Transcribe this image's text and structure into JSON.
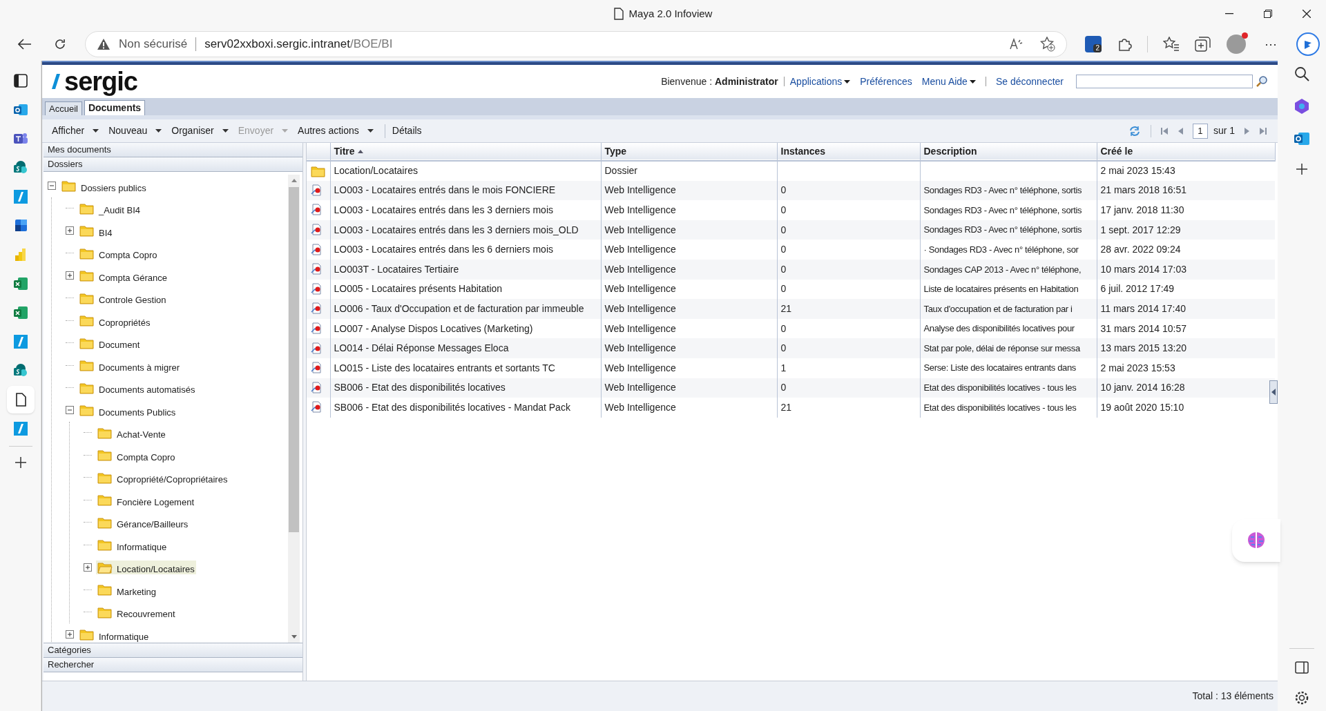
{
  "browser": {
    "title": "Maya 2.0 Infoview",
    "security": "Non sécurisé",
    "url_host": "serv02xxboxi.sergic.intranet",
    "url_path": "/BOE/BI",
    "extension_badge": "2",
    "more": "···"
  },
  "header": {
    "logo": "sergic",
    "welcome": "Bienvenue : **Administrator**",
    "links": [
      {
        "label": "Applications",
        "dropdown": true
      },
      {
        "label": "Préférences",
        "dropdown": false
      },
      {
        "label": "Menu Aide",
        "dropdown": true
      }
    ],
    "logout": "Se déconnecter"
  },
  "tabs": [
    {
      "label": "Accueil",
      "selected": false
    },
    {
      "label": "Documents",
      "selected": true
    }
  ],
  "toolbar": [
    {
      "label": "Afficher",
      "dropdown": true,
      "disabled": false
    },
    {
      "label": "Nouveau",
      "dropdown": true,
      "disabled": false
    },
    {
      "label": "Organiser",
      "dropdown": true,
      "disabled": false
    },
    {
      "label": "Envoyer",
      "dropdown": true,
      "disabled": true
    },
    {
      "label": "Autres actions",
      "dropdown": true,
      "disabled": false
    },
    {
      "label": "Détails",
      "dropdown": false,
      "disabled": false
    }
  ],
  "pager": {
    "page": "1",
    "of": "sur 1"
  },
  "sidebar": {
    "sections_top": [
      "Mes documents",
      "Dossiers"
    ],
    "sections_bottom": [
      "Catégories",
      "Rechercher"
    ],
    "tree": [
      {
        "label": "Dossiers publics",
        "kind": "expanded",
        "selected": false,
        "children": [
          {
            "label": "_Audit BI4",
            "kind": "leaf",
            "selected": false
          },
          {
            "label": "BI4",
            "kind": "collapsed",
            "selected": false
          },
          {
            "label": "Compta Copro",
            "kind": "leaf",
            "selected": false
          },
          {
            "label": "Compta Gérance",
            "kind": "collapsed",
            "selected": false
          },
          {
            "label": "Controle Gestion",
            "kind": "leaf",
            "selected": false
          },
          {
            "label": "Copropriétés",
            "kind": "leaf",
            "selected": false
          },
          {
            "label": "Document",
            "kind": "leaf",
            "selected": false
          },
          {
            "label": "Documents à migrer",
            "kind": "leaf",
            "selected": false
          },
          {
            "label": "Documents automatisés",
            "kind": "leaf",
            "selected": false
          },
          {
            "label": "Documents Publics",
            "kind": "expanded",
            "selected": false,
            "children": [
              {
                "label": "Achat-Vente",
                "kind": "leaf",
                "selected": false
              },
              {
                "label": "Compta Copro",
                "kind": "leaf",
                "selected": false
              },
              {
                "label": "Copropriété/Copropriétaires",
                "kind": "leaf",
                "selected": false
              },
              {
                "label": "Foncière Logement",
                "kind": "leaf",
                "selected": false
              },
              {
                "label": "Gérance/Bailleurs",
                "kind": "leaf",
                "selected": false
              },
              {
                "label": "Informatique",
                "kind": "leaf",
                "selected": false
              },
              {
                "label": "Location/Locataires",
                "kind": "collapsed",
                "selected": true
              },
              {
                "label": "Marketing",
                "kind": "leaf",
                "selected": false
              },
              {
                "label": "Recouvrement",
                "kind": "leaf",
                "selected": false
              }
            ]
          },
          {
            "label": "Informatique",
            "kind": "collapsed",
            "selected": false
          }
        ]
      }
    ]
  },
  "table": {
    "columns": [
      "Titre",
      "Type",
      "Instances",
      "Description",
      "Créé le"
    ],
    "rows": [
      {
        "kind": "folder",
        "cells": [
          "Location/Locataires",
          "Dossier",
          "",
          "",
          "2 mai 2023 15:43"
        ]
      },
      {
        "kind": "report",
        "cells": [
          "LO003 - Locataires entrés dans le mois FONCIERE",
          "Web Intelligence",
          "0",
          "Sondages RD3 - Avec n° téléphone, sortis",
          "21 mars 2018 16:51"
        ]
      },
      {
        "kind": "report",
        "cells": [
          "LO003 - Locataires entrés dans les 3 derniers mois",
          "Web Intelligence",
          "0",
          "Sondages RD3 - Avec n° téléphone, sortis",
          "17 janv. 2018 11:30"
        ]
      },
      {
        "kind": "report",
        "cells": [
          "LO003 - Locataires entrés dans les 3 derniers mois_OLD",
          "Web Intelligence",
          "0",
          "Sondages RD3 - Avec n° téléphone, sortis",
          "1 sept. 2017 12:29"
        ]
      },
      {
        "kind": "report",
        "cells": [
          "LO003 - Locataires entrés dans les 6 derniers mois",
          "Web Intelligence",
          "0",
          "· Sondages RD3 - Avec n° téléphone, sor",
          "28 avr. 2022 09:24"
        ]
      },
      {
        "kind": "report",
        "cells": [
          "LO003T - Locataires Tertiaire",
          "Web Intelligence",
          "0",
          "Sondages CAP 2013 - Avec n° téléphone,",
          "10 mars 2014 17:03"
        ]
      },
      {
        "kind": "report",
        "cells": [
          "LO005 - Locataires présents Habitation",
          "Web Intelligence",
          "0",
          "Liste de locataires présents en Habitation",
          "6 juil. 2012 17:49"
        ]
      },
      {
        "kind": "report",
        "cells": [
          "LO006 - Taux d'Occupation et de facturation par immeuble",
          "Web Intelligence",
          "21",
          "Taux d'occupation et de facturation par i",
          "11 mars 2014 17:40"
        ]
      },
      {
        "kind": "report",
        "cells": [
          "LO007 - Analyse Dispos Locatives (Marketing)",
          "Web Intelligence",
          "0",
          "Analyse des disponibilités locatives pour",
          "31 mars 2014 10:57"
        ]
      },
      {
        "kind": "report",
        "cells": [
          "LO014 - Délai Réponse Messages Eloca",
          "Web Intelligence",
          "0",
          "Stat par pole, délai de réponse sur messa",
          "13 mars 2015 13:20"
        ]
      },
      {
        "kind": "report",
        "cells": [
          "LO015 - Liste des locataires entrants et sortants TC",
          "Web Intelligence",
          "1",
          "Serse: Liste des locataires entrants dans",
          "2 mai 2023 15:53"
        ]
      },
      {
        "kind": "report",
        "cells": [
          "SB006 - Etat des disponibilités locatives",
          "Web Intelligence",
          "0",
          "Etat des disponibilités locatives - tous les",
          "10 janv. 2014 16:28"
        ]
      },
      {
        "kind": "report",
        "cells": [
          "SB006 - Etat des disponibilités locatives - Mandat Pack",
          "Web Intelligence",
          "21",
          "Etat des disponibilités locatives - tous les",
          "19 août 2020 15:10"
        ]
      }
    ]
  },
  "status": "Total : 13 éléments"
}
